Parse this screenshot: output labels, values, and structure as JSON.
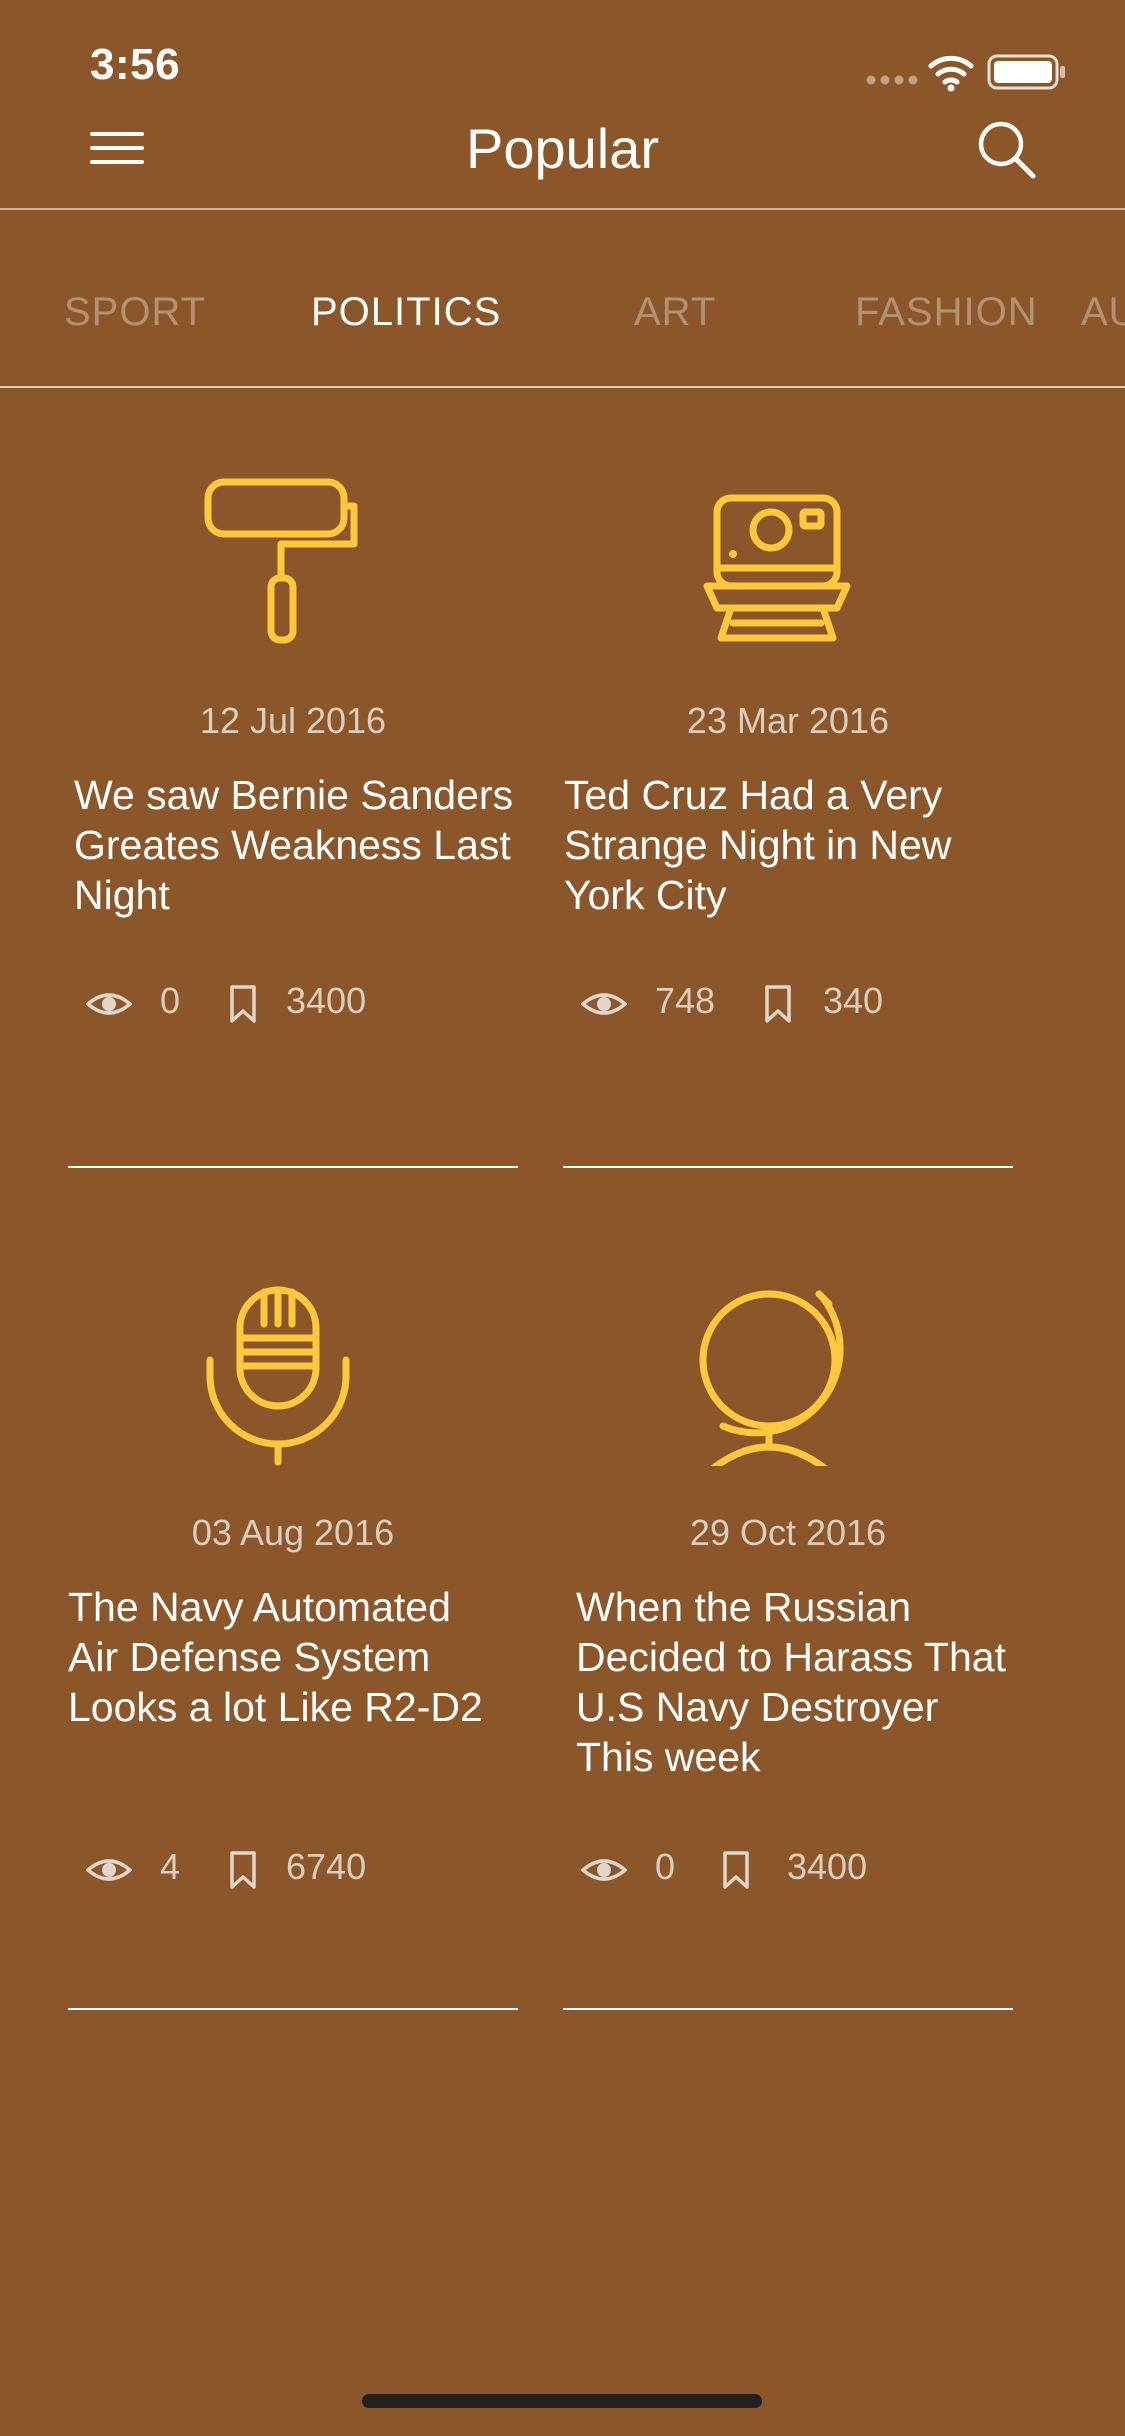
{
  "status_bar": {
    "time": "3:56"
  },
  "nav": {
    "title": "Popular"
  },
  "tabs": [
    {
      "label": "SPORT"
    },
    {
      "label": "POLITICS"
    },
    {
      "label": "ART"
    },
    {
      "label": "FASHION"
    },
    {
      "label": "AU"
    }
  ],
  "active_tab": "POLITICS",
  "colors": {
    "background": "#8b572a",
    "accent_icon": "#ffc83d",
    "text": "#ffffff"
  },
  "cards": [
    {
      "icon": "paint-roller-icon",
      "date": "12 Jul 2016",
      "title": "We saw Bernie Sanders Greates Weakness Last Night",
      "views": "0",
      "bookmarks": "3400"
    },
    {
      "icon": "polaroid-camera-icon",
      "date": "23 Mar 2016",
      "title": "Ted Cruz Had a Very Strange Night in New York City",
      "views": "748",
      "bookmarks": "340"
    },
    {
      "icon": "microphone-icon",
      "date": "03 Aug 2016",
      "title": "The Navy Automated Air Defense System Looks a lot Like R2-D2",
      "views": "4",
      "bookmarks": "6740"
    },
    {
      "icon": "globe-icon",
      "date": "29 Oct 2016",
      "title": "When the Russian Decided to Harass That U.S Navy Destroyer This week",
      "views": "0",
      "bookmarks": "3400"
    }
  ]
}
